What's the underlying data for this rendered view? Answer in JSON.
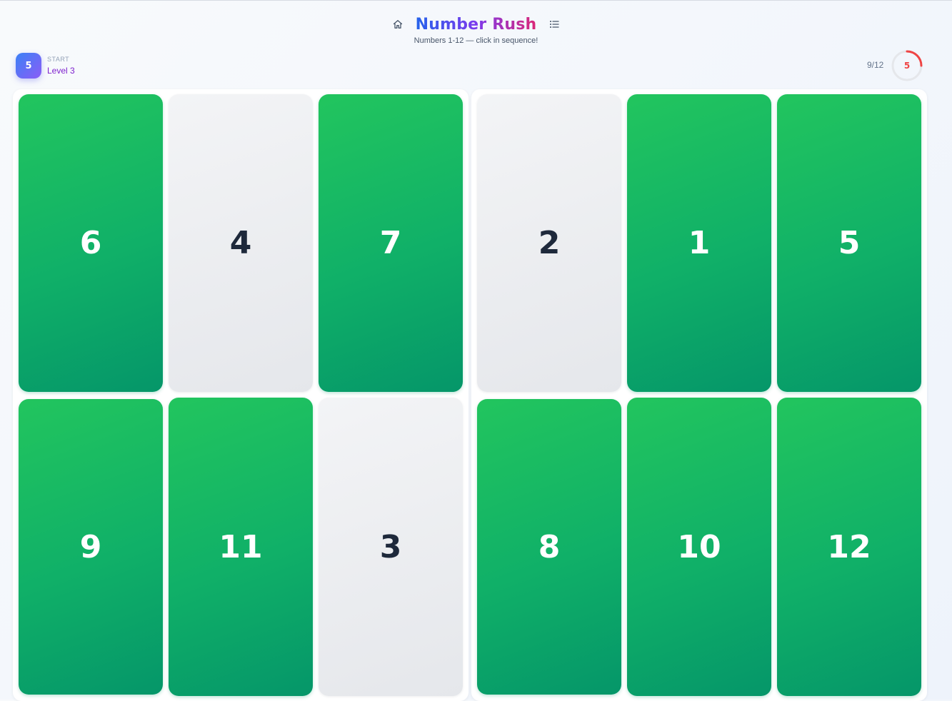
{
  "header": {
    "title": "Number Rush",
    "subtitle": "Numbers 1-12 — click in sequence!",
    "home_icon": "home-icon",
    "list_icon": "list-icon"
  },
  "level": {
    "badge": "5",
    "caption": "START",
    "name": "Level 3"
  },
  "progress": {
    "text": "9/12",
    "timer_value": "5",
    "timer_fraction": 0.25
  },
  "colors": {
    "done_start": "#22c55e",
    "done_end": "#059669",
    "pending": "#e5e7eb",
    "accent_blue": "#2563eb",
    "accent_purple": "#7c3aed",
    "accent_pink": "#db2777",
    "timer": "#ef4444"
  },
  "boards": [
    {
      "tiles": [
        {
          "label": "6",
          "state": "done"
        },
        {
          "label": "4",
          "state": "pending"
        },
        {
          "label": "7",
          "state": "done"
        },
        {
          "label": "9",
          "state": "done"
        },
        {
          "label": "11",
          "state": "done"
        },
        {
          "label": "3",
          "state": "pending"
        }
      ]
    },
    {
      "tiles": [
        {
          "label": "2",
          "state": "pending"
        },
        {
          "label": "1",
          "state": "done"
        },
        {
          "label": "5",
          "state": "done"
        },
        {
          "label": "8",
          "state": "done"
        },
        {
          "label": "10",
          "state": "done"
        },
        {
          "label": "12",
          "state": "done"
        }
      ]
    }
  ]
}
